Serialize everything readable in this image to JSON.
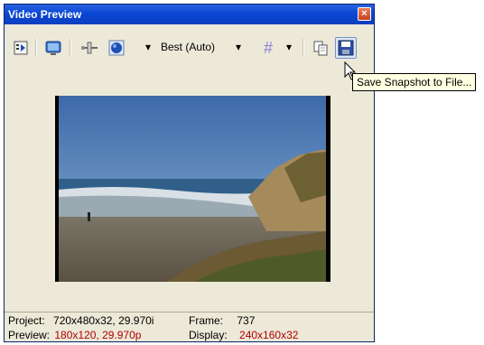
{
  "window": {
    "title": "Video Preview",
    "close_glyph": "×"
  },
  "toolbar": {
    "buttons": [
      {
        "name": "preview-properties",
        "icon": "properties-icon"
      },
      {
        "name": "external-monitor",
        "icon": "monitor-icon"
      },
      {
        "name": "split-screen",
        "icon": "split-screen-icon"
      },
      {
        "name": "preview-quality",
        "icon": "circle-icon"
      },
      {
        "name": "overlays",
        "icon": "grid-icon"
      },
      {
        "name": "copy-snapshot",
        "icon": "copy-icon"
      },
      {
        "name": "save-snapshot",
        "icon": "save-icon"
      }
    ],
    "quality_label": "Best (Auto)",
    "grid_glyph": "#",
    "dropdown_glyph": "▾"
  },
  "tooltip": {
    "text": "Save Snapshot to File..."
  },
  "status": {
    "project_label": "Project:",
    "project_value": "720x480x32, 29.970i",
    "frame_label": "Frame:",
    "frame_value": "737",
    "preview_label": "Preview:",
    "preview_value": "180x120, 29.970p",
    "display_label": "Display:",
    "display_value": "240x160x32"
  },
  "colors": {
    "title_bar": "#0a47d4",
    "panel": "#ece9d8",
    "red_text": "#b00000",
    "tooltip_bg": "#ffffe1"
  }
}
